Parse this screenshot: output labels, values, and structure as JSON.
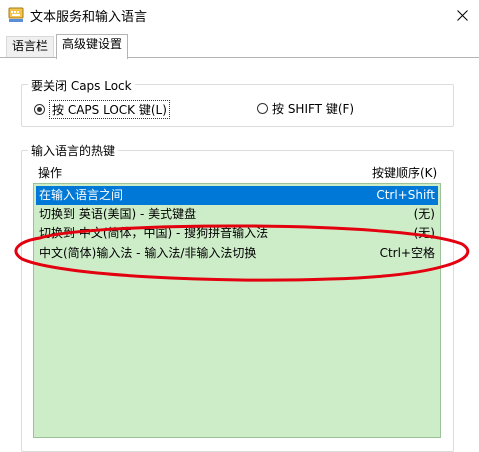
{
  "window": {
    "title": "文本服务和输入语言"
  },
  "tabs": [
    {
      "label": "语言栏",
      "active": false
    },
    {
      "label": "高级键设置",
      "active": true
    }
  ],
  "caps_group": {
    "title": "要关闭 Caps Lock",
    "options": [
      {
        "label": "按 CAPS LOCK 键(L)",
        "checked": true
      },
      {
        "label": "按 SHIFT 键(F)",
        "checked": false
      }
    ]
  },
  "hotkey_group": {
    "title": "输入语言的热键",
    "col_action": "操作",
    "col_key": "按键顺序(K)",
    "rows": [
      {
        "action": "在输入语言之间",
        "key": "Ctrl+Shift",
        "selected": true
      },
      {
        "action": "切换到 英语(美国) - 美式键盘",
        "key": "(无)",
        "selected": false
      },
      {
        "action": "切换到 中文(简体，中国) - 搜狗拼音输入法",
        "key": "(无)",
        "selected": false
      },
      {
        "action": "中文(简体)输入法 - 输入法/非输入法切换",
        "key": "Ctrl+空格",
        "selected": false
      }
    ]
  },
  "colors": {
    "selection": "#0078d7",
    "list_background": "#cdecc8",
    "annotation": "#e3000f"
  }
}
